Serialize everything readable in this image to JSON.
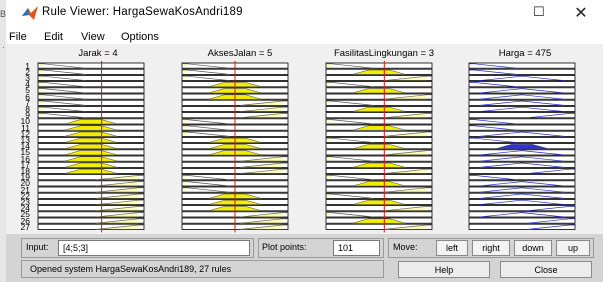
{
  "window": {
    "edge_letter": "B",
    "title": "Rule Viewer: HargaSewaKosAndri189",
    "maximize_glyph": "☐",
    "close_glyph": "✕"
  },
  "menu": [
    "File",
    "Edit",
    "View",
    "Options"
  ],
  "columns": [
    {
      "header": "Jarak = 4",
      "type": "input",
      "line": 0.6
    },
    {
      "header": "AksesJalan = 5",
      "type": "input",
      "line": 0.5
    },
    {
      "header": "FasilitasLingkungan = 3",
      "type": "input",
      "line": 0.55
    },
    {
      "header": "Harga = 475",
      "type": "output"
    }
  ],
  "rules": [
    "1",
    "2",
    "3",
    "4",
    "5",
    "6",
    "7",
    "8",
    "9",
    "10",
    "11",
    "12",
    "13",
    "14",
    "15",
    "16",
    "17",
    "18",
    "19",
    "20",
    "21",
    "22",
    "23",
    "24",
    "25",
    "26",
    "27"
  ],
  "rule_shapes": {
    "jarak": [
      "l",
      "l",
      "l",
      "l",
      "l",
      "l",
      "l",
      "l",
      "l",
      "M",
      "M",
      "M",
      "M",
      "M",
      "M",
      "M",
      "M",
      "M",
      "h",
      "h",
      "h",
      "h",
      "h",
      "h",
      "h",
      "h",
      "h"
    ],
    "akses": [
      "l",
      "l",
      "l",
      "M",
      "M",
      "M",
      "h",
      "h",
      "h",
      "l",
      "l",
      "l",
      "M",
      "M",
      "M",
      "h",
      "h",
      "h",
      "l",
      "l",
      "l",
      "M",
      "M",
      "M",
      "h",
      "h",
      "h"
    ],
    "fasil": [
      "l",
      "M",
      "h",
      "l",
      "M",
      "h",
      "l",
      "M",
      "h",
      "l",
      "M",
      "h",
      "l",
      "M",
      "h",
      "l",
      "M",
      "h",
      "l",
      "M",
      "h",
      "l",
      "M",
      "h",
      "l",
      "M",
      "h"
    ]
  },
  "output_shapes": [
    "l",
    "l",
    "m",
    "l",
    "m",
    "m",
    "m",
    "m",
    "h",
    "l",
    "l",
    "m",
    "l",
    "M",
    "m",
    "m",
    "m",
    "h",
    "l",
    "m",
    "m",
    "m",
    "m",
    "h",
    "m",
    "h",
    "h"
  ],
  "input": {
    "label": "Input:",
    "value": "[4;5;3]"
  },
  "plot_points": {
    "label": "Plot points:",
    "value": "101"
  },
  "move": {
    "label": "Move:",
    "buttons": [
      "left",
      "right",
      "down",
      "up"
    ]
  },
  "status": "Opened system HargaSewaKosAndri189, 27 rules",
  "help_label": "Help",
  "close_label": "Close",
  "colors": {
    "fill": "#f2ee00",
    "output_fill": "#3030e8",
    "line": "#e01010",
    "frame": "#000000"
  }
}
